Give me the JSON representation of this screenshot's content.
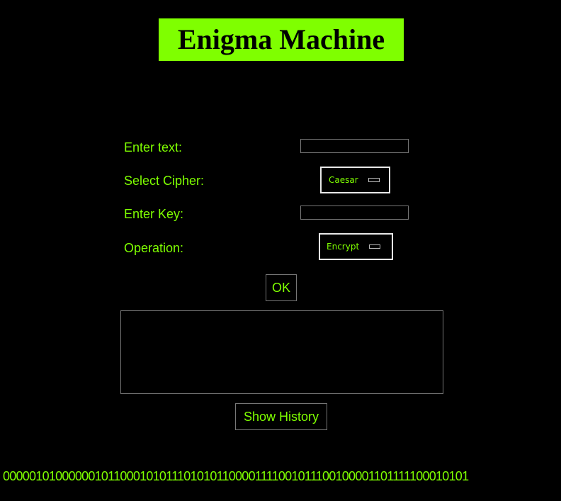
{
  "window": {
    "title": "Enigma Machine"
  },
  "form": {
    "text_label": "Enter text:",
    "text_value": "",
    "cipher_label": "Select Cipher:",
    "cipher_selected": "Caesar",
    "key_label": "Enter Key:",
    "key_value": "",
    "operation_label": "Operation:",
    "operation_selected": "Encrypt",
    "ok_label": "OK"
  },
  "output": {
    "text": ""
  },
  "history": {
    "button_label": "Show History"
  },
  "footer": {
    "binary_text": "0000010100000010110001010111010101100001111001011100100001101111100010101"
  },
  "colors": {
    "background": "#000000",
    "accent": "#7fff00",
    "title_text": "#000000",
    "border": "#777777"
  }
}
